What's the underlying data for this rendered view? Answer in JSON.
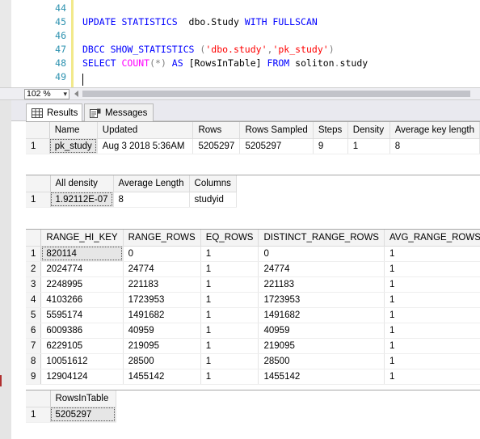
{
  "editor": {
    "lines": [
      {
        "num": "44",
        "tokens": []
      },
      {
        "num": "45",
        "tokens": [
          {
            "t": "UPDATE STATISTICS",
            "c": "kw"
          },
          {
            "t": "  dbo.Study ",
            "c": "tx"
          },
          {
            "t": "WITH FULLSCAN",
            "c": "kw"
          }
        ]
      },
      {
        "num": "46",
        "tokens": []
      },
      {
        "num": "47",
        "tokens": [
          {
            "t": "DBCC SHOW_STATISTICS",
            "c": "kw"
          },
          {
            "t": " (",
            "c": "op"
          },
          {
            "t": "'dbo.study'",
            "c": "str"
          },
          {
            "t": ",",
            "c": "op"
          },
          {
            "t": "'pk_study'",
            "c": "str"
          },
          {
            "t": ")",
            "c": "op"
          }
        ]
      },
      {
        "num": "48",
        "tokens": [
          {
            "t": "SELECT ",
            "c": "kw"
          },
          {
            "t": "COUNT",
            "c": "fn"
          },
          {
            "t": "(*)",
            "c": "op"
          },
          {
            "t": " AS ",
            "c": "kw"
          },
          {
            "t": "[RowsInTable] ",
            "c": "tx"
          },
          {
            "t": "FROM ",
            "c": "kw"
          },
          {
            "t": "soliton",
            "c": "tx"
          },
          {
            "t": ".",
            "c": "op"
          },
          {
            "t": "study",
            "c": "tx"
          }
        ]
      },
      {
        "num": "49",
        "tokens": []
      }
    ]
  },
  "zoom": {
    "level": "102 %"
  },
  "tabs": {
    "results": "Results",
    "messages": "Messages"
  },
  "header_grid": {
    "columns": [
      "Name",
      "Updated",
      "Rows",
      "Rows Sampled",
      "Steps",
      "Density",
      "Average key length"
    ],
    "rows": [
      [
        "1",
        "pk_study",
        "Aug  3 2018  5:36AM",
        "5205297",
        "5205297",
        "9",
        "1",
        "8"
      ]
    ]
  },
  "density_grid": {
    "columns": [
      "All density",
      "Average Length",
      "Columns"
    ],
    "rows": [
      [
        "1",
        "1.92112E-07",
        "8",
        "studyid"
      ]
    ]
  },
  "histogram_grid": {
    "columns": [
      "RANGE_HI_KEY",
      "RANGE_ROWS",
      "EQ_ROWS",
      "DISTINCT_RANGE_ROWS",
      "AVG_RANGE_ROWS"
    ],
    "rows": [
      [
        "1",
        "820114",
        "0",
        "1",
        "0",
        "1"
      ],
      [
        "2",
        "2024774",
        "24774",
        "1",
        "24774",
        "1"
      ],
      [
        "3",
        "2248995",
        "221183",
        "1",
        "221183",
        "1"
      ],
      [
        "4",
        "4103266",
        "1723953",
        "1",
        "1723953",
        "1"
      ],
      [
        "5",
        "5595174",
        "1491682",
        "1",
        "1491682",
        "1"
      ],
      [
        "6",
        "6009386",
        "40959",
        "1",
        "40959",
        "1"
      ],
      [
        "7",
        "6229105",
        "219095",
        "1",
        "219095",
        "1"
      ],
      [
        "8",
        "10051612",
        "28500",
        "1",
        "28500",
        "1"
      ],
      [
        "9",
        "12904124",
        "1455142",
        "1",
        "1455142",
        "1"
      ]
    ]
  },
  "count_grid": {
    "columns": [
      "RowsInTable"
    ],
    "rows": [
      [
        "1",
        "5205297"
      ]
    ]
  }
}
